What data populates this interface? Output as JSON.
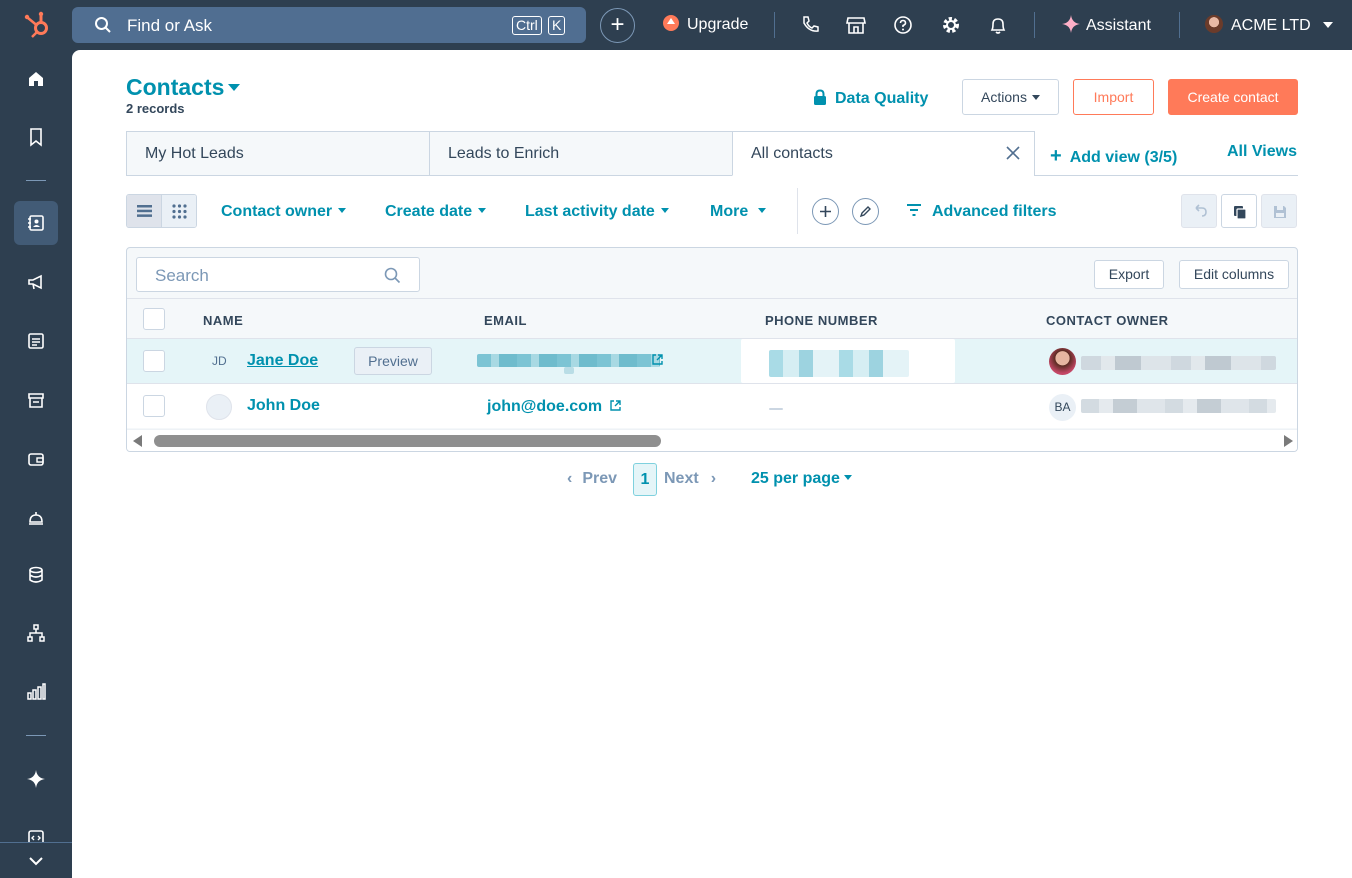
{
  "topbar": {
    "search_placeholder": "Find or Ask",
    "kbd_ctrl": "Ctrl",
    "kbd_k": "K",
    "upgrade_label": "Upgrade",
    "assistant_label": "Assistant",
    "account_name": "ACME LTD"
  },
  "header": {
    "title": "Contacts",
    "record_count": "2 records",
    "data_quality_label": "Data Quality",
    "actions_label": "Actions",
    "import_label": "Import",
    "create_label": "Create contact"
  },
  "tabs": [
    {
      "label": "My Hot Leads"
    },
    {
      "label": "Leads to Enrich"
    },
    {
      "label": "All contacts"
    }
  ],
  "add_view_label": "Add view (3/5)",
  "all_views_label": "All Views",
  "filters": {
    "contact_owner": "Contact owner",
    "create_date": "Create date",
    "last_activity": "Last activity date",
    "more": "More",
    "advanced": "Advanced filters"
  },
  "table": {
    "search_placeholder": "Search",
    "export_label": "Export",
    "edit_columns_label": "Edit columns",
    "columns": [
      "NAME",
      "EMAIL",
      "PHONE NUMBER",
      "CONTACT OWNER"
    ],
    "rows": [
      {
        "initials": "JD",
        "name": "Jane Doe",
        "preview": "Preview",
        "email": "",
        "phone": "",
        "owner": ""
      },
      {
        "initials": "",
        "name": "John Doe",
        "email": "john@doe.com",
        "phone": "",
        "owner_initials": "BA"
      }
    ]
  },
  "pagination": {
    "prev": "Prev",
    "current": "1",
    "next": "Next",
    "per_page": "25 per page"
  },
  "colors": {
    "nav_bg": "#2e3f50",
    "accent": "#0091ae",
    "primary_button": "#ff7a59"
  }
}
